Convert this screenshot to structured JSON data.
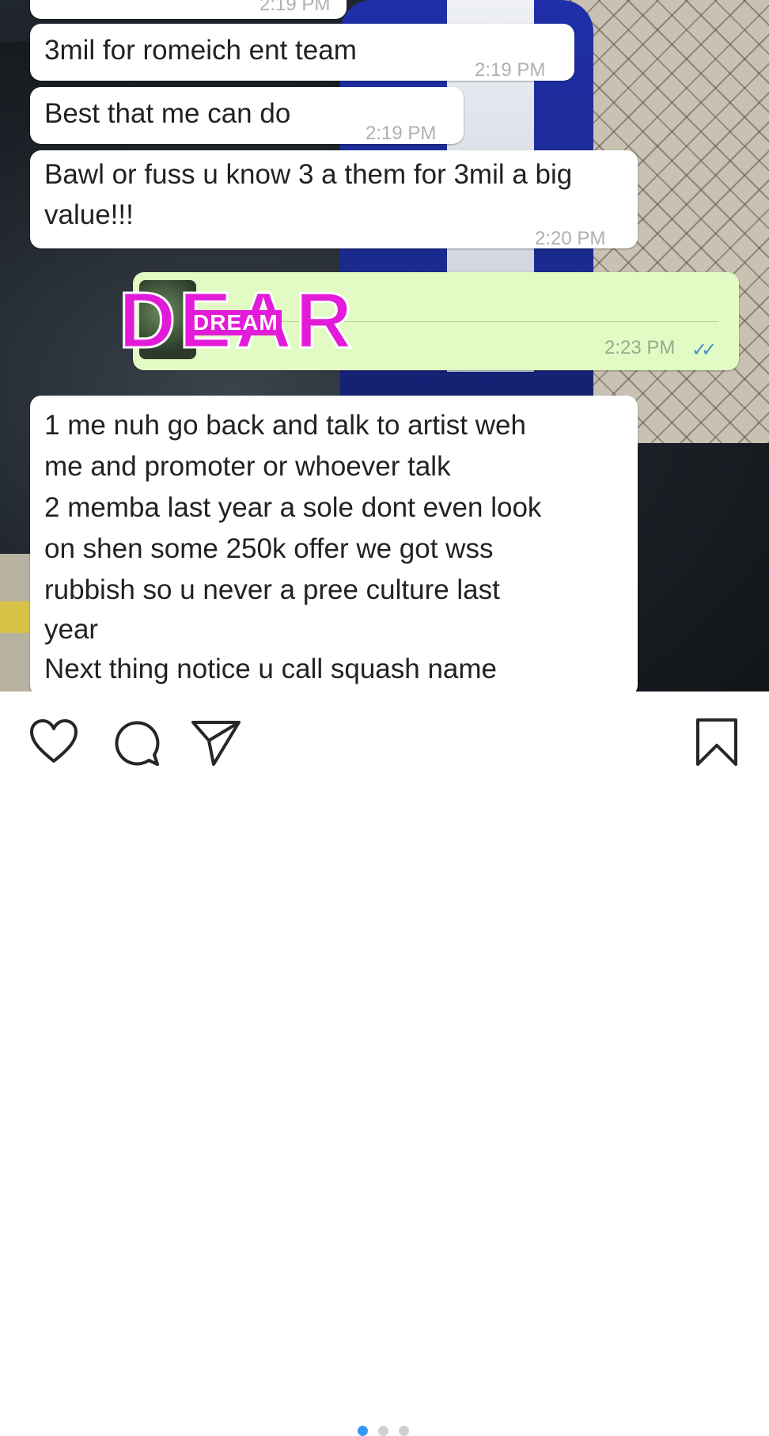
{
  "messages": {
    "partial_top": {
      "time": "2:19 PM"
    },
    "incoming": [
      {
        "text": "3mil for romeich ent team",
        "time": "2:19 PM"
      },
      {
        "text": "Best that me can do",
        "time": "2:19 PM"
      },
      {
        "text": "Bawl or fuss u know 3 a them for 3mil a big value!!!",
        "time": "2:20 PM"
      }
    ],
    "outgoing": {
      "time": "2:23 PM",
      "status_icon": "double-check-icon",
      "sticker_text": "DEAR",
      "sticker_overlay": "DREAM"
    },
    "long_message_lines": [
      "1 me nuh go back and talk to artist weh",
      "me and promoter or whoever talk",
      "2 memba last year a sole dont even look",
      "on shen some 250k offer we got wss",
      "rubbish so u never a pree culture last",
      "year",
      "Next thing notice u call squash name"
    ]
  },
  "actions": {
    "like": "heart-icon",
    "comment": "comment-icon",
    "share": "send-icon",
    "save": "bookmark-icon"
  },
  "carousel": {
    "count": 3,
    "active_index": 0,
    "active_color": "#3897f0",
    "inactive_color": "#d0d0d0"
  },
  "colors": {
    "outgoing_bubble": "#e2fbc4",
    "sticker": "#e21bd9",
    "read_ticks": "#4a8fd6"
  }
}
